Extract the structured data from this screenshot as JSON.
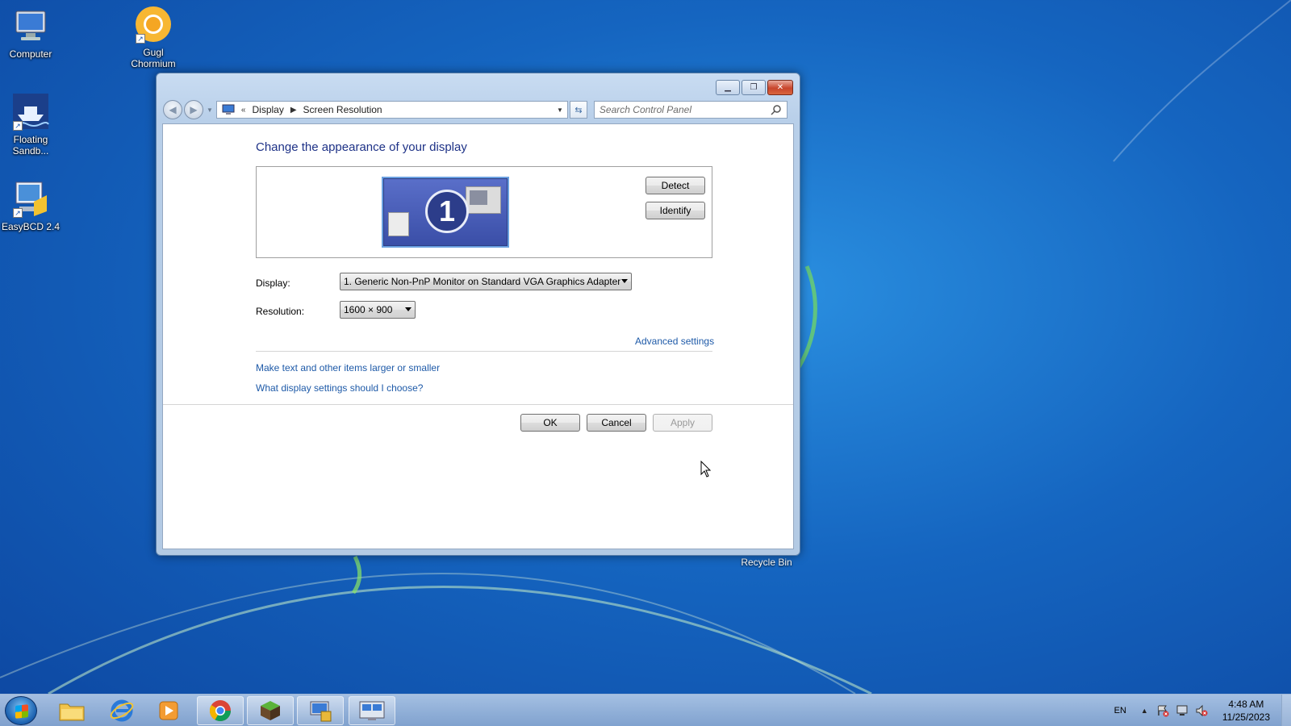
{
  "desktop": {
    "icons": [
      {
        "label": "Computer",
        "icon": "computer-icon"
      },
      {
        "label": "Gugl Chormium",
        "icon": "chromium-icon"
      },
      {
        "label": "Floating Sandb...",
        "icon": "floating-sandbox-icon"
      },
      {
        "label": "EasyBCD 2.4",
        "icon": "easybcd-icon"
      },
      {
        "label": "Recycle Bin",
        "icon": "recycle-bin-icon"
      }
    ]
  },
  "window": {
    "breadcrumb": {
      "overflow": "«",
      "items": [
        "Display",
        "Screen Resolution"
      ]
    },
    "search": {
      "placeholder": "Search Control Panel"
    },
    "title": "Change the appearance of your display",
    "monitor_number": "1",
    "detect_label": "Detect",
    "identify_label": "Identify",
    "display": {
      "label": "Display:",
      "value": "1. Generic Non-PnP Monitor on Standard VGA Graphics Adapter"
    },
    "resolution": {
      "label": "Resolution:",
      "value": "1600 × 900"
    },
    "links": {
      "advanced": "Advanced settings",
      "text_size": "Make text and other items larger or smaller",
      "help": "What display settings should I choose?"
    },
    "buttons": {
      "ok": "OK",
      "cancel": "Cancel",
      "apply": "Apply"
    }
  },
  "taskbar": {
    "pinned": [
      "start-orb",
      "file-explorer-icon",
      "internet-explorer-icon",
      "media-player-icon",
      "chrome-icon",
      "minecraft-icon",
      "control-panel-icon",
      "screen-resolution-icon"
    ],
    "language": "EN",
    "time": "4:48 AM",
    "date": "11/25/2023"
  }
}
